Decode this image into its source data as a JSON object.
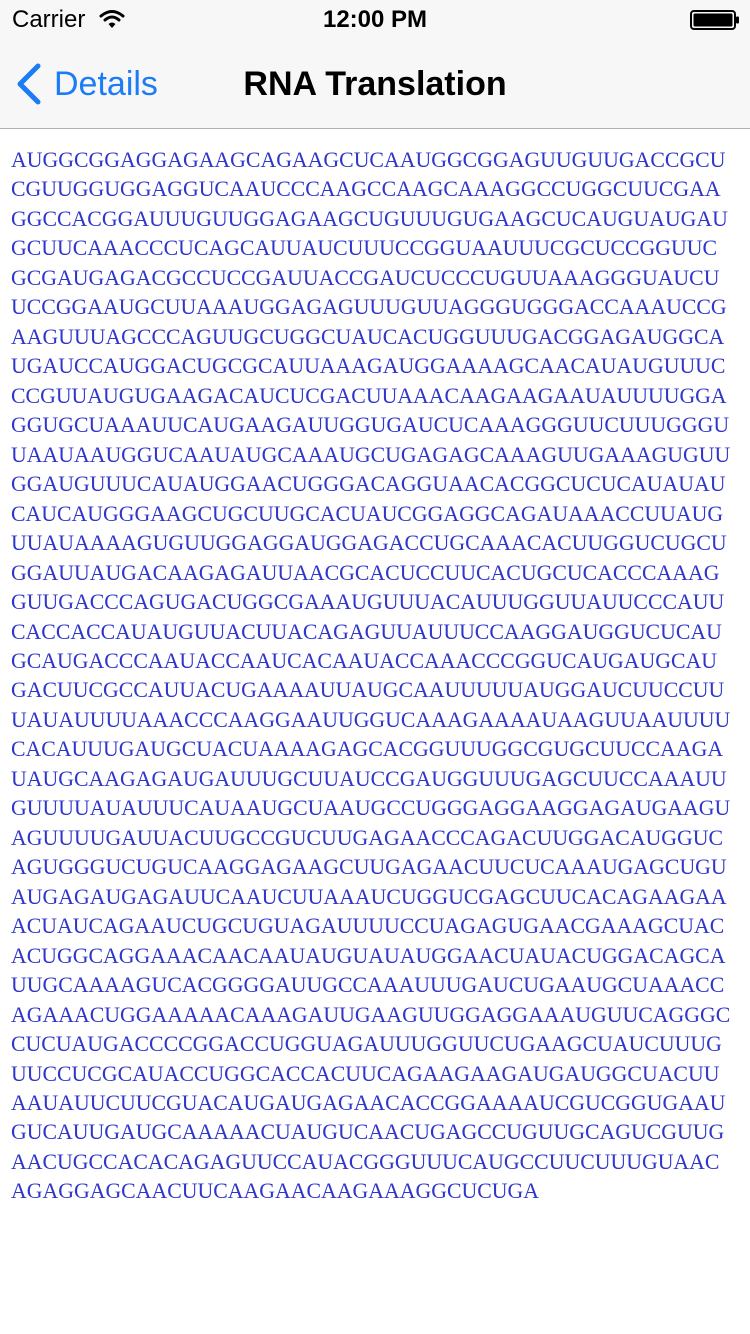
{
  "status_bar": {
    "carrier": "Carrier",
    "time": "12:00 PM",
    "icons": [
      "wifi-icon",
      "battery-icon"
    ]
  },
  "nav": {
    "back_label": "Details",
    "title": "RNA Translation",
    "back_icon": "chevron-left-icon",
    "accent_color": "#1b7cf6"
  },
  "content": {
    "text_color": "#2f36c9",
    "sequence_lines": [
      "AUGGCGGAGGAGAAGCAGAAGCUCAAUGGCGGAGUUGUUGACCGCU",
      "CGUUGGUGGAGGUCAAUCCCAAGCCAAGCAAAGGCCUGGCUUCGAA",
      "GGCCACGGAUUUGUUGGAGAAGCUGUUUGUGAAGCUCAUGUAUGAU",
      "GCUUCAAACCCUCAGCAUUAUCUUUCCGGUAAUUUCGCUCCGGUUC",
      "GCGAUGAGACGCCUCCGAUUACCGAUCUCCCUGUUAAAGGGUAUCU",
      "UCCGGAAUGCUUAAAUGGAGAGUUUGUUAGGGUGGGACCAAAUCCG",
      "AAGUUUAGCCCAGUUGCUGGCUAUCACUGGUUUGACGGAGAUGGCA",
      "UGAUCCAUGGACUGCGCAUUAAAGAUGGAAAAGCAACAUAUGUUUC",
      "CCGUUAUGUGAAGACAUCUCGACUUAAACAAGAAGAAUAUUUUGGA",
      "GGUGCUAAAUUCAUGAAGAUUGGUGAUCUCAAAGGGUUCUUUGGGU",
      "UAAUAAUGGUCAAUAUGCAAAUGCUGAGAGCAAAGUUGAAAGUGUU",
      "GGAUGUUUCAUAUGGAACUGGGACAGGUAACACGGCUCUCAUAUAU",
      "CAUCAUGGGAAGCUGCUUGCACUAUCGGAGGCAGAUAAACCUUAUG",
      "UUAUAAAAGUGUUGGAGGAUGGAGACCUGCAAACACUUGGUCUGCU",
      "GGAUUAUGACAAGAGAUUAACGCACUCCUUCACUGCUCACCCAAAG",
      "GUUGACCCAGUGACUGGCGAAAUGUUUACAUUUGGUUAUUCCCAUU",
      "CACCACCAUAUGUUACUUACAGAGUUAUUUCCAAGGAUGGUCUCAU",
      "GCAUGACCCAAUACCAAUCACAAUACCAAACCCGGUCAUGAUGCAU",
      "GACUUCGCCAUUACUGAAAAUUAUGCAAUUUUUAUGGAUCUUCCUU",
      "UAUAUUUUAAACCCAAGGAAUUGGUCAAAGAAAAUAAGUUAAUUUU",
      "CACAUUUGAUGCUACUAAAAGAGCACGGUUUGGCGUGCUUCCAAGA",
      "UAUGCAAGAGAUGAUUUGCUUAUCCGAUGGUUUGAGCUUCCAAAUU",
      "GUUUUAUAUUUCAUAAUGCUAAUGCCUGGGAGGAAGGAGAUGAAGU",
      "AGUUUUGAUUACUUGCCGUCUUGAGAACCCAGACUUGGACAUGGUC",
      "AGUGGGUCUGUCAAGGAGAAGCUUGAGAACUUCUCAAAUGAGCUGU",
      "AUGAGAUGAGAUUCAAUCUUAAAUCUGGUCGAGCUUCACAGAAGAA",
      "ACUAUCAGAAUCUGCUGUAGAUUUUCCUAGAGUGAACGAAAGCUAC",
      "ACUGGCAGGAAACAACAAUAUGUAUAUGGAACUAUACUGGACAGCA",
      "UUGCAAAAGUCACGGGGAUUGCCAAAUUUGAUCUGAAUGCUAAACC",
      "AGAAACUGGAAAAACAAAGAUUGAAGUUGGAGGAAAUGUUCAGGGC",
      "CUCUAUGACCCCGGACCUGGUAGAUUUGGUUCUGAAGCUAUCUUUG",
      "UUCCUCGCAUACCUGGCACCACUUCAGAAGAAGAUGAUGGCUACUU",
      "AAUAUUCUUCGUACAUGAUGAGAACACCGGAAAAUCGUCGGUGAAU",
      "GUCAUUGAUGCAAAAACUAUGUCAACUGAGCCUGUUGCAGUCGUUG",
      "AACUGCCACACAGAGUUCCAUACGGGUUUCAUGCCUUCUUUGUAAC",
      "AGAGGAGCAACUUCAAGAACAAGAAAGGCUCUGA"
    ]
  }
}
